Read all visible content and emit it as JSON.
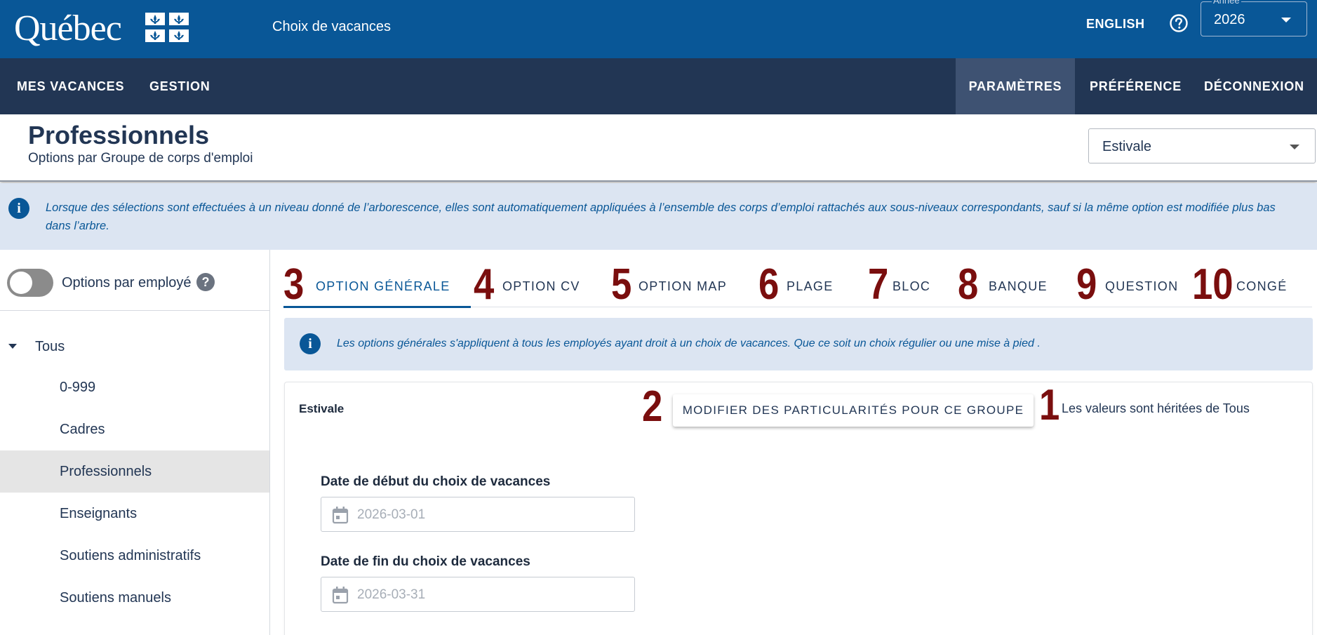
{
  "header": {
    "logo_text": "Québec",
    "app_title": "Choix de vacances",
    "language_link": "ENGLISH",
    "year_select": {
      "legend": "Année",
      "value": "2026"
    }
  },
  "nav": {
    "left": [
      "MES VACANCES",
      "GESTION"
    ],
    "right": [
      "PARAMÈTRES",
      "PRÉFÉRENCE",
      "DÉCONNEXION"
    ],
    "active": "PARAMÈTRES"
  },
  "page": {
    "title": "Professionnels",
    "subtitle": "Options par Groupe de corps d'emploi",
    "season_select": "Estivale"
  },
  "info_banner": "Lorsque des sélections sont effectuées à un niveau donné de l’arborescence, elles sont automatiquement appliquées à l’ensemble des corps d’emploi rattachés aux sous-niveaux correspondants, sauf si la même option est modifiée plus bas dans l’arbre.",
  "sidebar": {
    "toggle_label": "Options par employé",
    "toggle_on": false,
    "help_badge": "?",
    "tree_root": "Tous",
    "tree_items": [
      "0-999",
      "Cadres",
      "Professionnels",
      "Enseignants",
      "Soutiens administratifs",
      "Soutiens manuels"
    ],
    "selected_item": "Professionnels"
  },
  "tabs": [
    {
      "number": "3",
      "label": "OPTION GÉNÉRALE",
      "active": true
    },
    {
      "number": "4",
      "label": "OPTION CV"
    },
    {
      "number": "5",
      "label": "OPTION MAP"
    },
    {
      "number": "6",
      "label": "PLAGE"
    },
    {
      "number": "7",
      "label": "BLOC"
    },
    {
      "number": "8",
      "label": "BANQUE"
    },
    {
      "number": "9",
      "label": "QUESTION"
    },
    {
      "number": "10",
      "label": "CONGÉ"
    }
  ],
  "tab_info": "Les options générales s'appliquent à tous les employés ayant droit à un choix de vacances. Que ce soit un choix régulier ou une mise à pied .",
  "card": {
    "title": "Estivale",
    "annotation_button": "2",
    "modify_button": "MODIFIER DES PARTICULARITÉS POUR CE GROUPE",
    "annotation_inherit": "1",
    "inherit_text": "Les valeurs sont héritées de Tous",
    "fields": [
      {
        "label": "Date de début du choix de vacances",
        "value": "2026-03-01"
      },
      {
        "label": "Date de fin du choix de vacances",
        "value": "2026-03-31"
      }
    ]
  },
  "colors": {
    "primary_blue": "#095797",
    "nav_dark": "#223654",
    "nav_active": "#3e5272",
    "info_bg": "#dce5f2",
    "annotation_red": "#7a0e0e"
  },
  "icons": [
    "fleur-de-lis-flag-icon",
    "help-circle-icon",
    "chevron-down-icon",
    "info-icon",
    "calendar-icon",
    "caret-down-icon"
  ]
}
